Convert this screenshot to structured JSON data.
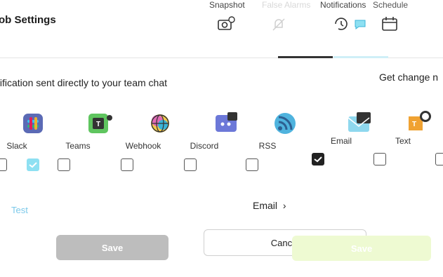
{
  "header": {
    "title": "ob Settings",
    "tabs": [
      {
        "label": "Snapshot",
        "icon": "camera-gear-icon"
      },
      {
        "label": "False Alarms",
        "icon": "bell-off-icon"
      },
      {
        "label": "Notifications",
        "icon": "history-icon"
      },
      {
        "label": "Schedule",
        "icon": "calendar-icon"
      }
    ]
  },
  "notifications": {
    "subtitle": "tification sent directly to your team chat",
    "right_link": "Get change n",
    "services": [
      {
        "label": "Slack",
        "icon": "slack-icon",
        "checked": true
      },
      {
        "label": "Teams",
        "icon": "teams-icon",
        "checked": false
      },
      {
        "label": "Webhook",
        "icon": "webhook-icon",
        "checked": false
      },
      {
        "label": "Discord",
        "icon": "discord-icon",
        "checked": false
      },
      {
        "label": "RSS",
        "icon": "rss-icon",
        "checked": false
      },
      {
        "label": "Email",
        "icon": "email-icon",
        "checked": true
      },
      {
        "label": "Text",
        "icon": "text-icon",
        "checked": false
      }
    ],
    "email_link": "Email",
    "blue_link": "Test",
    "chevron": "›"
  },
  "footer": {
    "save_grey": "Save",
    "cancel": "Cancel",
    "save_green": "Save"
  },
  "colors": {
    "accent_light": "#8ee0f2",
    "save_green": "#eefad2",
    "save_grey": "#bdbdbd"
  }
}
